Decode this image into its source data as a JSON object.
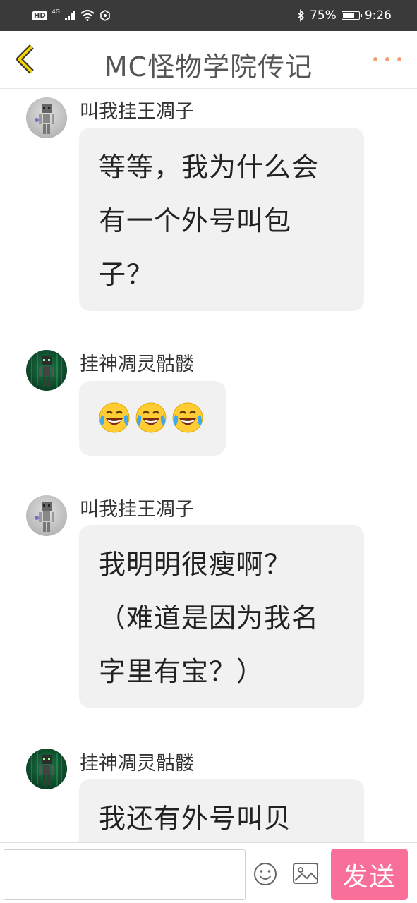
{
  "status_bar": {
    "hd": "HD",
    "network": "4G",
    "battery": "75%",
    "time": "9:26",
    "battery_level": 0.75
  },
  "header": {
    "title": "MC怪物学院传记",
    "back_icon": "chevron-left-icon",
    "more_icon": "more-dots-icon"
  },
  "messages": [
    {
      "sender": "叫我挂王凋子",
      "avatar": "gray-skeleton-avatar",
      "lines": [
        "等等，我为什么会",
        "有一个外号叫包",
        "子？"
      ]
    },
    {
      "sender": "挂神凋灵骷髅",
      "avatar": "green-skeleton-avatar",
      "emoji": [
        "laugh-cry-emoji",
        "laugh-cry-emoji",
        "laugh-cry-emoji"
      ]
    },
    {
      "sender": "叫我挂王凋子",
      "avatar": "gray-skeleton-avatar",
      "lines": [
        "我明明很瘦啊？",
        "（难道是因为我名",
        "字里有宝？）"
      ]
    },
    {
      "sender": "挂神凋灵骷髅",
      "avatar": "green-skeleton-avatar",
      "lines": [
        "我还有外号叫贝"
      ]
    }
  ],
  "input_bar": {
    "value": "",
    "send_label": "发送",
    "emoji_icon": "smiley-icon",
    "image_icon": "image-icon",
    "accent_color": "#f8709a"
  }
}
